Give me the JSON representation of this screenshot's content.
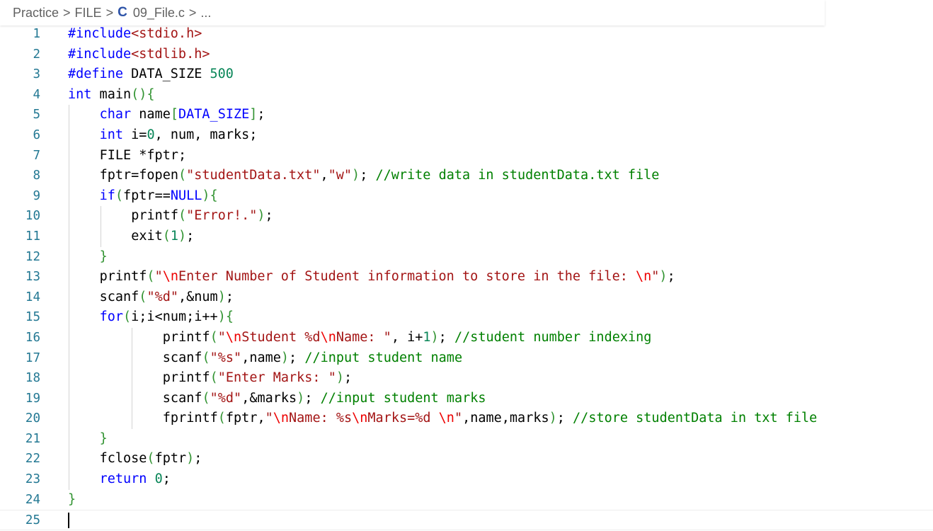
{
  "breadcrumb": {
    "items": [
      "Practice",
      "FILE"
    ],
    "file_icon": "C",
    "file_name": "09_File.c",
    "tail": "..."
  },
  "colors": {
    "preprocessor": "#0000ff",
    "keyword": "#0000ff",
    "string": "#a31515",
    "number": "#098658",
    "comment": "#008000",
    "line_number": "#237893"
  },
  "editor": {
    "active_line": 25,
    "lines": [
      {
        "n": "1",
        "tokens": [
          [
            "preproc",
            "#include"
          ],
          [
            "include",
            "<stdio.h>"
          ]
        ]
      },
      {
        "n": "2",
        "tokens": [
          [
            "preproc",
            "#include"
          ],
          [
            "include",
            "<stdlib.h>"
          ]
        ]
      },
      {
        "n": "3",
        "tokens": [
          [
            "preproc",
            "#define"
          ],
          [
            "plain",
            " DATA_SIZE "
          ],
          [
            "num",
            "500"
          ]
        ]
      },
      {
        "n": "4",
        "tokens": [
          [
            "kw",
            "int"
          ],
          [
            "plain",
            " main"
          ],
          [
            "brace",
            "(){"
          ]
        ]
      },
      {
        "n": "5",
        "indent": 1,
        "tokens": [
          [
            "kw",
            "char"
          ],
          [
            "plain",
            " name"
          ],
          [
            "brace",
            "["
          ],
          [
            "macro",
            "DATA_SIZE"
          ],
          [
            "brace",
            "]"
          ],
          [
            "plain",
            ";"
          ]
        ]
      },
      {
        "n": "6",
        "indent": 1,
        "tokens": [
          [
            "kw",
            "int"
          ],
          [
            "plain",
            " i="
          ],
          [
            "num",
            "0"
          ],
          [
            "plain",
            ", num, marks;"
          ]
        ]
      },
      {
        "n": "7",
        "indent": 1,
        "tokens": [
          [
            "plain",
            "FILE *fptr;"
          ]
        ]
      },
      {
        "n": "8",
        "indent": 1,
        "tokens": [
          [
            "plain",
            "fptr=fopen"
          ],
          [
            "brace",
            "("
          ],
          [
            "str",
            "\"studentData.txt\""
          ],
          [
            "plain",
            ","
          ],
          [
            "str",
            "\"w\""
          ],
          [
            "brace",
            ")"
          ],
          [
            "plain",
            "; "
          ],
          [
            "comment",
            "//write data in studentData.txt file"
          ]
        ]
      },
      {
        "n": "9",
        "indent": 1,
        "tokens": [
          [
            "kw",
            "if"
          ],
          [
            "brace",
            "("
          ],
          [
            "plain",
            "fptr=="
          ],
          [
            "macro",
            "NULL"
          ],
          [
            "brace",
            "){"
          ]
        ]
      },
      {
        "n": "10",
        "indent": 2,
        "tokens": [
          [
            "plain",
            "printf"
          ],
          [
            "brace",
            "("
          ],
          [
            "str",
            "\"Error!.\""
          ],
          [
            "brace",
            ")"
          ],
          [
            "plain",
            ";"
          ]
        ]
      },
      {
        "n": "11",
        "indent": 2,
        "tokens": [
          [
            "plain",
            "exit"
          ],
          [
            "brace",
            "("
          ],
          [
            "num",
            "1"
          ],
          [
            "brace",
            ")"
          ],
          [
            "plain",
            ";"
          ]
        ]
      },
      {
        "n": "12",
        "indent": 1,
        "tokens": [
          [
            "brace",
            "}"
          ]
        ]
      },
      {
        "n": "13",
        "indent": 1,
        "tokens": [
          [
            "plain",
            "printf"
          ],
          [
            "brace",
            "("
          ],
          [
            "str",
            "\""
          ],
          [
            "esc",
            "\\n"
          ],
          [
            "str",
            "Enter Number of Student information to store in the file: "
          ],
          [
            "esc",
            "\\n"
          ],
          [
            "str",
            "\""
          ],
          [
            "brace",
            ")"
          ],
          [
            "plain",
            ";"
          ]
        ]
      },
      {
        "n": "14",
        "indent": 1,
        "tokens": [
          [
            "plain",
            "scanf"
          ],
          [
            "brace",
            "("
          ],
          [
            "str",
            "\"%d\""
          ],
          [
            "plain",
            ",&num"
          ],
          [
            "brace",
            ")"
          ],
          [
            "plain",
            ";"
          ]
        ]
      },
      {
        "n": "15",
        "indent": 1,
        "tokens": [
          [
            "kw",
            "for"
          ],
          [
            "brace",
            "("
          ],
          [
            "plain",
            "i;i<num;i++"
          ],
          [
            "brace",
            "){"
          ]
        ]
      },
      {
        "n": "16",
        "indent": 3,
        "tokens": [
          [
            "plain",
            "printf"
          ],
          [
            "brace",
            "("
          ],
          [
            "str",
            "\""
          ],
          [
            "esc",
            "\\n"
          ],
          [
            "str",
            "Student %d"
          ],
          [
            "esc",
            "\\n"
          ],
          [
            "str",
            "Name: \""
          ],
          [
            "plain",
            ", i+"
          ],
          [
            "num",
            "1"
          ],
          [
            "brace",
            ")"
          ],
          [
            "plain",
            "; "
          ],
          [
            "comment",
            "//student number indexing"
          ]
        ]
      },
      {
        "n": "17",
        "indent": 3,
        "tokens": [
          [
            "plain",
            "scanf"
          ],
          [
            "brace",
            "("
          ],
          [
            "str",
            "\"%s\""
          ],
          [
            "plain",
            ",name"
          ],
          [
            "brace",
            ")"
          ],
          [
            "plain",
            "; "
          ],
          [
            "comment",
            "//input student name"
          ]
        ]
      },
      {
        "n": "18",
        "indent": 3,
        "tokens": [
          [
            "plain",
            "printf"
          ],
          [
            "brace",
            "("
          ],
          [
            "str",
            "\"Enter Marks: \""
          ],
          [
            "brace",
            ")"
          ],
          [
            "plain",
            ";"
          ]
        ]
      },
      {
        "n": "19",
        "indent": 3,
        "tokens": [
          [
            "plain",
            "scanf"
          ],
          [
            "brace",
            "("
          ],
          [
            "str",
            "\"%d\""
          ],
          [
            "plain",
            ",&marks"
          ],
          [
            "brace",
            ")"
          ],
          [
            "plain",
            "; "
          ],
          [
            "comment",
            "//input student marks"
          ]
        ]
      },
      {
        "n": "20",
        "indent": 3,
        "tokens": [
          [
            "plain",
            "fprintf"
          ],
          [
            "brace",
            "("
          ],
          [
            "plain",
            "fptr,"
          ],
          [
            "str",
            "\""
          ],
          [
            "esc",
            "\\n"
          ],
          [
            "str",
            "Name: %s"
          ],
          [
            "esc",
            "\\n"
          ],
          [
            "str",
            "Marks=%d "
          ],
          [
            "esc",
            "\\n"
          ],
          [
            "str",
            "\""
          ],
          [
            "plain",
            ",name,marks"
          ],
          [
            "brace",
            ")"
          ],
          [
            "plain",
            "; "
          ],
          [
            "comment",
            "//store studentData in txt file"
          ]
        ]
      },
      {
        "n": "21",
        "indent": 1,
        "tokens": [
          [
            "brace",
            "}"
          ]
        ]
      },
      {
        "n": "22",
        "indent": 1,
        "tokens": [
          [
            "plain",
            "fclose"
          ],
          [
            "brace",
            "("
          ],
          [
            "plain",
            "fptr"
          ],
          [
            "brace",
            ")"
          ],
          [
            "plain",
            ";"
          ]
        ]
      },
      {
        "n": "23",
        "indent": 1,
        "tokens": [
          [
            "kw",
            "return"
          ],
          [
            "plain",
            " "
          ],
          [
            "num",
            "0"
          ],
          [
            "plain",
            ";"
          ]
        ]
      },
      {
        "n": "24",
        "tokens": [
          [
            "brace",
            "}"
          ]
        ]
      },
      {
        "n": "25",
        "tokens": []
      }
    ]
  }
}
